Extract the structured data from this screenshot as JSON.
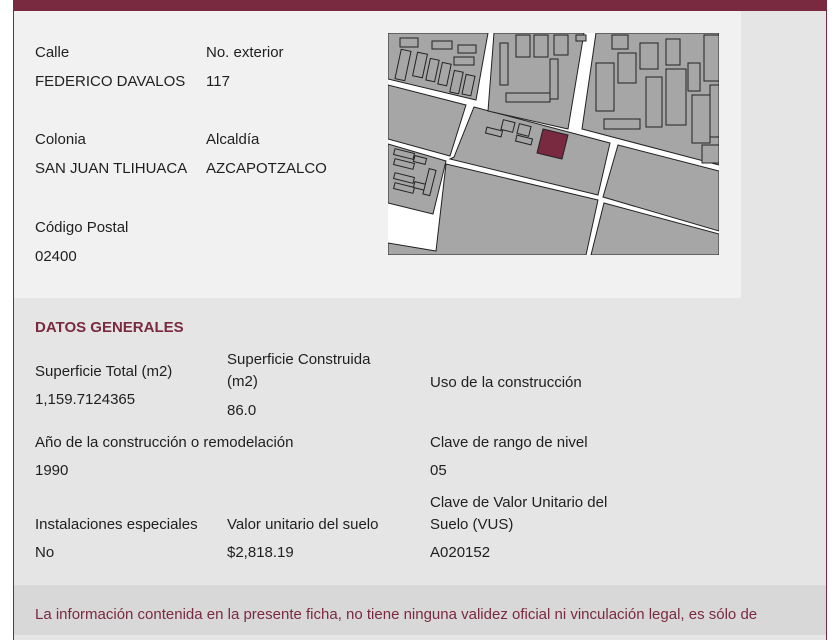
{
  "address": {
    "street_label": "Calle",
    "street_value": "FEDERICO DAVALOS",
    "ext_label": "No. exterior",
    "ext_value": "117",
    "colonia_label": "Colonia",
    "colonia_value": "SAN JUAN TLIHUACA",
    "alcaldia_label": "Alcaldía",
    "alcaldia_value": "AZCAPOTZALCO",
    "cp_label": "Código Postal",
    "cp_value": "02400"
  },
  "general": {
    "section_title": "DATOS GENERALES",
    "sup_total_label": "Superficie Total (m2)",
    "sup_total_value": "1,159.7124365",
    "sup_construida_label": "Superficie Construida (m2)",
    "sup_construida_value": "86.0",
    "uso_label": "Uso de la construcción",
    "uso_value": "",
    "anio_label": "Año de la construcción o remodelación",
    "anio_value": "1990",
    "rango_label": "Clave de rango de nivel",
    "rango_value": "05",
    "instalaciones_label": "Instalaciones especiales",
    "instalaciones_value": "No",
    "valor_suelo_label": "Valor unitario del suelo",
    "valor_suelo_value": "$2,818.19",
    "vus_label": "Clave de Valor Unitario del Suelo (VUS)",
    "vus_value": "A020152"
  },
  "footer": {
    "disclaimer": "La información contenida en la presente ficha, no tiene ninguna validez oficial ni vinculación legal, es sólo de"
  },
  "colors": {
    "brand": "#7a2a40",
    "map_block": "#a6a6a6",
    "map_lot_highlight": "#7a2a40"
  }
}
